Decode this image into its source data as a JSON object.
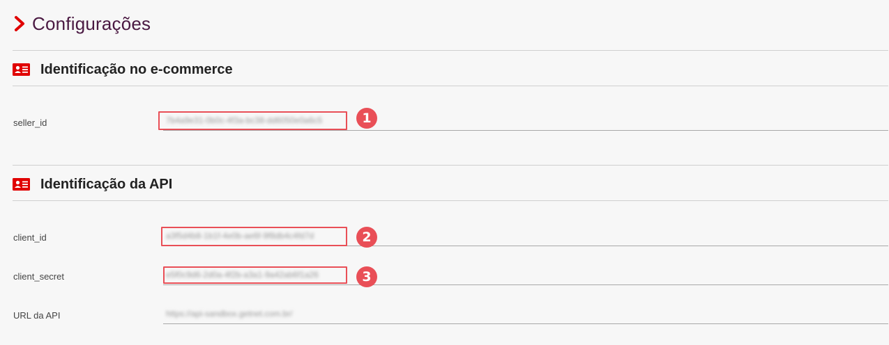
{
  "page": {
    "title": "Configurações",
    "chevron_icon": "chevron-right-icon",
    "accent_color": "#e00000",
    "highlight_color": "#e94f57"
  },
  "sections": [
    {
      "title": "Identificação no e-commerce",
      "icon": "id-card-icon",
      "fields": [
        {
          "label": "seller_id",
          "value": "7b4a9e31-0b0c-4f3a-bc38-dd6050e0a6c5",
          "marker": "1"
        }
      ]
    },
    {
      "title": "Identificação da API",
      "icon": "id-card-icon",
      "fields": [
        {
          "label": "client_id",
          "value": "a3f5d4b8-1b1f-4e0b-ae6f-9f8db4c4fd7d",
          "marker": "2"
        },
        {
          "label": "client_secret",
          "value": "e5f0c9d6-2d0a-4f2b-a3a1-9a42ab6f1a26",
          "marker": "3"
        },
        {
          "label": "URL da API",
          "value": "https://api-sandbox.getnet.com.br/",
          "marker": ""
        }
      ]
    }
  ]
}
